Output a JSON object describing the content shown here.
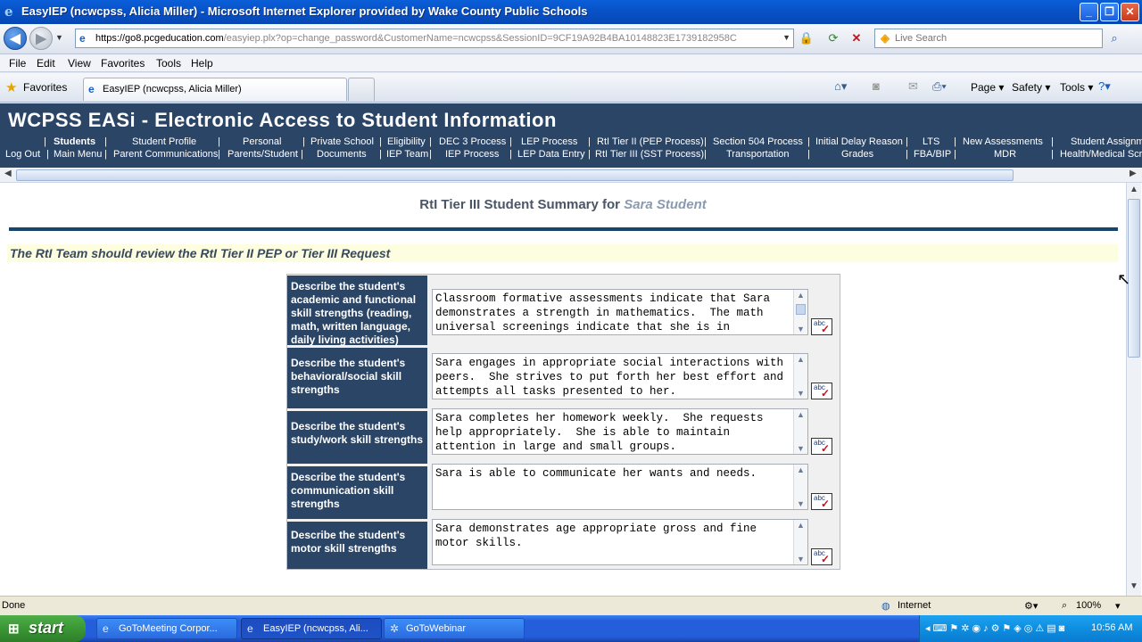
{
  "window": {
    "title": "EasyIEP (ncwcpss, Alicia Miller) - Microsoft Internet Explorer provided by Wake County Public Schools",
    "minimize": "_",
    "restore": "❐",
    "close": "✕"
  },
  "address": {
    "url_host": "https://go8.pcgeducation.com",
    "url_path": "/easyiep.plx?op=change_password&CustomerName=ncwcpss&SessionID=9CF19A92B4BA10148823E1739182958C",
    "search_placeholder": "Live Search"
  },
  "menu": [
    "File",
    "Edit",
    "View",
    "Favorites",
    "Tools",
    "Help"
  ],
  "tabs": {
    "favorites": "Favorites",
    "active_tab": "EasyIEP (ncwcpss, Alicia Miller)",
    "commands": {
      "page": "Page ▾",
      "safety": "Safety ▾",
      "tools": "Tools ▾"
    }
  },
  "app": {
    "title": "WCPSS EASi - Electronic Access to Student Information",
    "nav_row1": [
      "Students",
      "Student Profile",
      "Personal",
      "Private School",
      "Eligibility",
      "DEC 3 Process",
      "LEP Process",
      "RtI Tier II (PEP Process)",
      "Section 504 Process",
      "Initial Delay Reason",
      "LTS",
      "New Assessments",
      "Student Assignm"
    ],
    "nav_row2": [
      "Log Out",
      "Main Menu",
      "Parent Communications",
      "Parents/Student",
      "Documents",
      "IEP Team",
      "IEP Process",
      "LEP Data Entry",
      "RtI Tier III (SST Process)",
      "Transportation",
      "Grades",
      "FBA/BIP",
      "MDR",
      "Health/Medical Scre"
    ]
  },
  "summary": {
    "title_prefix": "RtI Tier III Student Summary for",
    "student": "Sara Student",
    "notice": "The RtI Team should review the RtI Tier II PEP or Tier III Request"
  },
  "questions": [
    {
      "label": "Describe the student's academic and functional skill strengths (reading, math, written language, daily living activities)",
      "answer": "Classroom formative assessments indicate that Sara demonstrates a strength in mathematics.  The math universal screenings indicate that she is in"
    },
    {
      "label": "Describe the student's behavioral/social skill strengths",
      "answer": "Sara engages in appropriate social interactions with peers.  She strives to put forth her best effort and attempts all tasks presented to her."
    },
    {
      "label": "Describe the student's study/work skill strengths",
      "answer": "Sara completes her homework weekly.  She requests help appropriately.  She is able to maintain attention in large and small groups."
    },
    {
      "label": "Describe the student's communication skill strengths",
      "answer": "Sara is able to communicate her wants and needs."
    },
    {
      "label": "Describe the student's motor skill strengths",
      "answer": "Sara demonstrates age appropriate gross and fine motor skills."
    }
  ],
  "spell_label": "abc",
  "status": {
    "left": "Done",
    "zone": "Internet",
    "zoom": "100%"
  },
  "taskbar": {
    "start": "start",
    "tasks": [
      "GoToMeeting Corpor...",
      "EasyIEP (ncwcpss, Ali...",
      "GoToWebinar"
    ],
    "clock": "10:56 AM"
  },
  "colors": {
    "banner": "#2b4566",
    "rule": "#17456e",
    "notice_bg": "#fdfde0"
  }
}
